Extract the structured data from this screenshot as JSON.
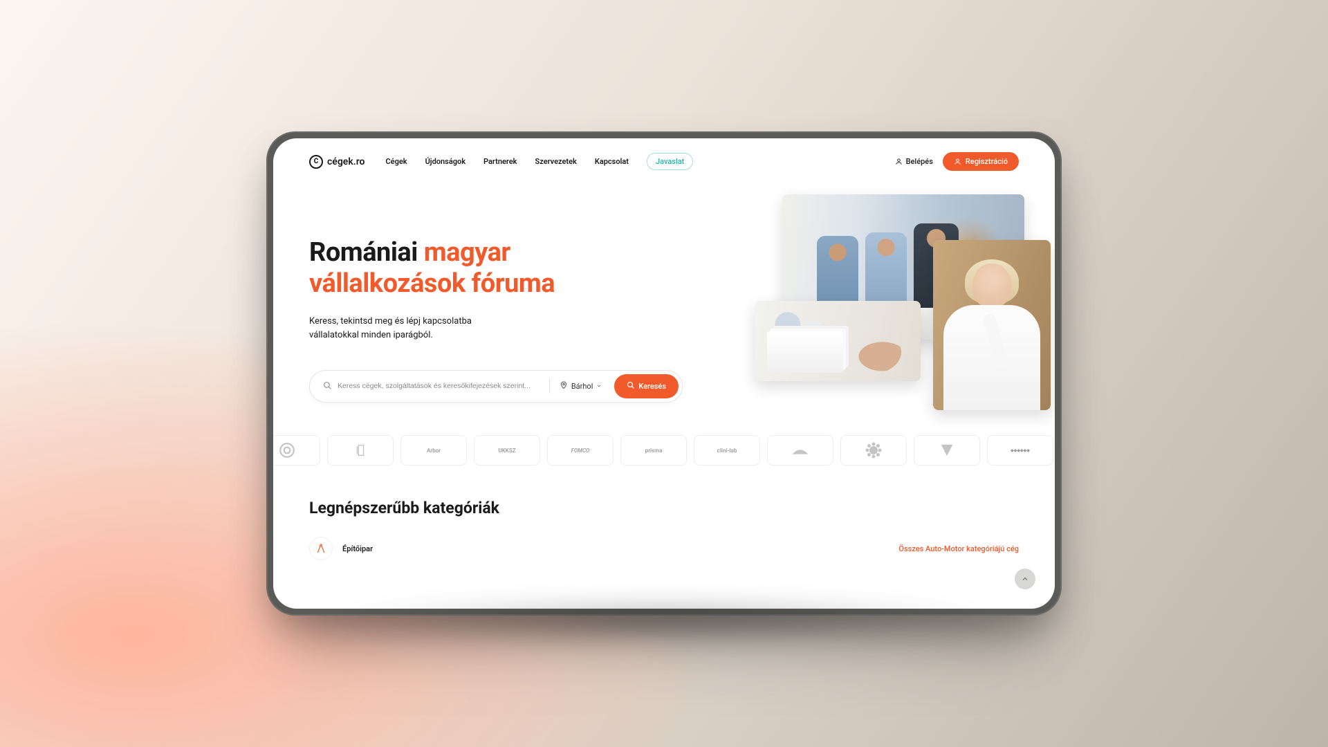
{
  "brand": {
    "name": "cégek.ro",
    "mark": "C"
  },
  "nav": {
    "items": [
      "Cégek",
      "Újdonságok",
      "Partnerek",
      "Szervezetek",
      "Kapcsolat"
    ],
    "suggestion": "Javaslat",
    "login": "Belépés",
    "register": "Regisztráció"
  },
  "hero": {
    "title_plain": "Romániai ",
    "title_accent": "magyar vállalkozások fóruma",
    "subtitle": "Keress, tekintsd meg és lépj kapcsolatba vállalatokkal minden iparágból."
  },
  "search": {
    "placeholder": "Keress cégek, szolgáltatások és keresőkifejezések szerint...",
    "location": "Bárhol",
    "button": "Keresés"
  },
  "logos": [
    "",
    "",
    "Arbor",
    "UKKSZ",
    "FOMCO",
    "prisma",
    "clini-lab",
    "",
    "",
    "",
    "",
    ""
  ],
  "categories": {
    "title": "Legnépszerűbb kategóriák",
    "first_item": "Építőipar",
    "all_link": "Összes Auto-Motor kategóriájú cég"
  }
}
